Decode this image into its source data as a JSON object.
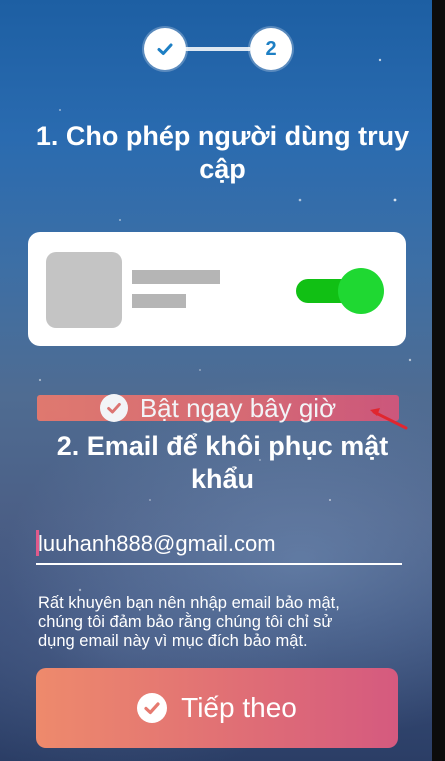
{
  "stepper": {
    "step1_icon": "check-icon",
    "step2_number": "2"
  },
  "section1": {
    "title_line1": "1. Cho phép người dùng truy",
    "title_line2": "cập"
  },
  "enable_button": {
    "label": "Bật ngay bây giờ",
    "icon": "check-circle-icon",
    "accent_color": "#e06b72"
  },
  "section2": {
    "title_line1": "2. Email để khôi phục mật",
    "title_line2": "khẩu"
  },
  "email": {
    "value": "luuhanh888@gmail.com"
  },
  "note": {
    "line1": "Rất khuyên bạn nên nhập email bảo mật,",
    "line2": "chúng tôi đảm bảo rằng chúng tôi chỉ sử",
    "line3": "dụng email này vì mục đích bảo mật."
  },
  "next_button": {
    "label": "Tiếp theo",
    "icon": "check-circle-icon"
  },
  "colors": {
    "toggle_on": "#1fd832",
    "button_gradient_start": "#ee8a6c",
    "button_gradient_end": "#d55a7f",
    "arrow": "#e0262f"
  }
}
